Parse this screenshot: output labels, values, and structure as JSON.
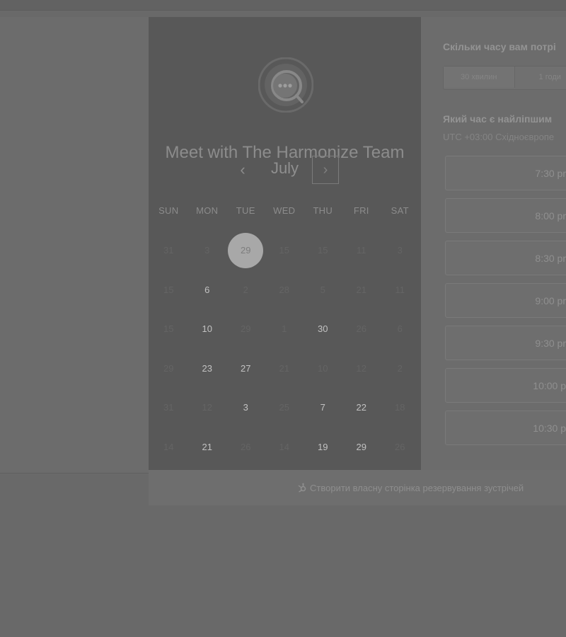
{
  "calendar": {
    "title": "Meet with The Harmonize Team",
    "month": "July",
    "prev_glyph": "‹",
    "next_glyph": "›",
    "weekdays": [
      "SUN",
      "MON",
      "TUE",
      "WED",
      "THU",
      "FRI",
      "SAT"
    ],
    "weeks": [
      [
        {
          "d": "31",
          "a": false
        },
        {
          "d": "3",
          "a": false
        },
        {
          "d": "29",
          "a": true,
          "s": true
        },
        {
          "d": "15",
          "a": false
        },
        {
          "d": "15",
          "a": false
        },
        {
          "d": "11",
          "a": false
        },
        {
          "d": "3",
          "a": false
        }
      ],
      [
        {
          "d": "15",
          "a": false
        },
        {
          "d": "6",
          "a": true
        },
        {
          "d": "2",
          "a": false
        },
        {
          "d": "28",
          "a": false
        },
        {
          "d": "5",
          "a": false
        },
        {
          "d": "21",
          "a": false
        },
        {
          "d": "11",
          "a": false
        }
      ],
      [
        {
          "d": "15",
          "a": false
        },
        {
          "d": "10",
          "a": true
        },
        {
          "d": "29",
          "a": false
        },
        {
          "d": "1",
          "a": false
        },
        {
          "d": "30",
          "a": true
        },
        {
          "d": "26",
          "a": false
        },
        {
          "d": "6",
          "a": false
        }
      ],
      [
        {
          "d": "29",
          "a": false
        },
        {
          "d": "23",
          "a": true
        },
        {
          "d": "27",
          "a": true
        },
        {
          "d": "21",
          "a": false
        },
        {
          "d": "10",
          "a": false
        },
        {
          "d": "12",
          "a": false
        },
        {
          "d": "2",
          "a": false
        }
      ],
      [
        {
          "d": "31",
          "a": false
        },
        {
          "d": "12",
          "a": false
        },
        {
          "d": "3",
          "a": true
        },
        {
          "d": "25",
          "a": false
        },
        {
          "d": "7",
          "a": true
        },
        {
          "d": "22",
          "a": true
        },
        {
          "d": "18",
          "a": false
        }
      ],
      [
        {
          "d": "14",
          "a": false
        },
        {
          "d": "21",
          "a": true
        },
        {
          "d": "26",
          "a": false
        },
        {
          "d": "14",
          "a": false
        },
        {
          "d": "19",
          "a": true
        },
        {
          "d": "29",
          "a": true
        },
        {
          "d": "26",
          "a": false
        }
      ]
    ]
  },
  "duration": {
    "question": "Скільки часу вам потрі",
    "options": [
      "30 хвилин",
      "1 годи"
    ]
  },
  "times": {
    "question": "Який час є найліпшим",
    "timezone": "UTC +03:00 Східноєвропе",
    "slots": [
      "7:30 pr",
      "8:00 pr",
      "8:30 pr",
      "9:00 pr",
      "9:30 pr",
      "10:00 p",
      "10:30 p"
    ]
  },
  "footer": {
    "link": "Створити власну сторінка резервування зустрічей"
  }
}
